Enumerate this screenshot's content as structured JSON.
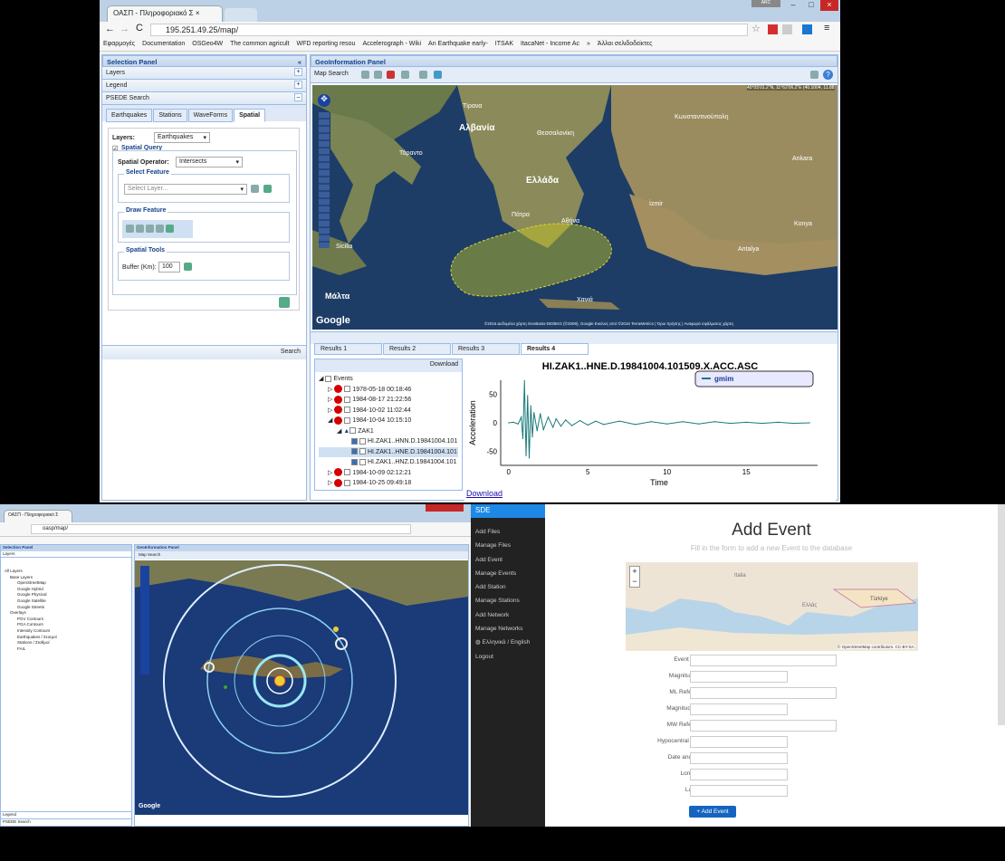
{
  "win1": {
    "tab_title": "ΟΑΣΠ - Πληροφοριακό Σ",
    "url": "195.251.49.25/map/",
    "user_badge": "ARC",
    "bookmarks": [
      "Εφαρμογές",
      "Documentation",
      "OSGeo4W",
      "The common agricult",
      "WFD reporting resou",
      "Accelerograph - Wiki",
      "An Earthquake early-",
      "ITSAK",
      "ItacaNet - Income Ac"
    ],
    "bookmarks_more": "»",
    "other_bookmarks": "Άλλοι σελιδοδείκτες",
    "selection_panel": "Selection Panel",
    "layers": "Layers",
    "legend": "Legend",
    "psede_search": "PSEDE Search",
    "search_tabs": [
      "Earthquakes",
      "Stations",
      "WaveForms",
      "Spatial"
    ],
    "layers_label": "Layers:",
    "layers_value": "Earthquakes",
    "spatial_query": "Spatial Query",
    "spatial_operator_label": "Spatial Operator:",
    "spatial_operator_value": "Intersects",
    "select_feature": "Select Feature",
    "select_layer_placeholder": "Select Layer...",
    "draw_feature": "Draw Feature",
    "spatial_tools": "Spatial Tools",
    "buffer_label": "Buffer (Km):",
    "buffer_value": "100",
    "search_button": "Search",
    "geo_panel": "GeoInformation Panel",
    "map_search": "Map Search",
    "map_coords": "40°05'01.2\"N, 11°62'06.2\"E (40.1004, 11.88",
    "map_labels": {
      "albania": "Αλβανία",
      "greece": "Ελλάδα",
      "malta": "Μάλτα",
      "tirana": "Τίρανα",
      "athens": "Αθήνα",
      "izmir": "İzmir",
      "antalya": "Antalya",
      "istanbul": "Κωνσταντινούπολη",
      "ankara": "Ankara",
      "konya": "Konya",
      "patra": "Πάτρα",
      "thessaloniki": "Θεσσαλονίκη",
      "sicily": "Sicilia",
      "taranto": "Τάραντο",
      "chania": "Χανιά"
    },
    "google": "Google",
    "map_footer": "©2016 Δεδομένα χάρτη GeoBasis-DE/BKG (©2009), Google Εικόνες από ©2016 TerraMetrics | Όροι Χρήσης | Αναφορά σφάλματος χάρτη",
    "result_tabs": [
      "Results 1",
      "Results 2",
      "Results 3",
      "Results 4"
    ],
    "download_button": "Download",
    "tree_root": "Events",
    "tree_events": [
      "1978-05-18 00:18:46",
      "1984-08-17 21:22:56",
      "1984-10-02 11:02:44",
      "1984-10-04 10:15:10"
    ],
    "station": "ZAK1",
    "waveforms": [
      "HI.ZAK1..HNN.D.19841004.101",
      "HI.ZAK1..HNE.D.19841004.101",
      "HI.ZAK1..HNZ.D.19841004.101"
    ],
    "tree_events2": [
      "1984-10-09 02:12:21",
      "1984-10-25 09:49:18"
    ],
    "download_link": "Download"
  },
  "chart_data": {
    "type": "line",
    "title": "HI.ZAK1..HNE.D.19841004.101509.X.ACC.ASC",
    "xlabel": "Time",
    "ylabel": "Acceleration",
    "xlim": [
      -0.5,
      19.5
    ],
    "ylim": [
      -75,
      75
    ],
    "xticks": [
      0,
      5,
      10,
      15
    ],
    "yticks": [
      50,
      0,
      -50
    ],
    "series": [
      {
        "name": "gmim",
        "color": "#1a7a7a",
        "x": [
          0,
          0.3,
          0.6,
          0.8,
          0.9,
          1.0,
          1.1,
          1.2,
          1.3,
          1.4,
          1.5,
          1.6,
          1.8,
          2.0,
          2.2,
          2.5,
          2.8,
          3.0,
          3.3,
          3.6,
          4.0,
          4.5,
          5.0,
          5.5,
          6.0,
          7.0,
          8.0,
          9.0,
          10.0,
          11.0,
          12.0,
          13.0,
          14.0,
          15.0,
          16.0,
          17.0,
          18.0,
          19.0
        ],
        "y": [
          0,
          1,
          -2,
          10,
          -28,
          74,
          -58,
          48,
          -62,
          30,
          -25,
          18,
          -14,
          16,
          -12,
          10,
          -8,
          7,
          -6,
          5,
          -5,
          4,
          -4,
          3,
          -3,
          3,
          -3,
          2,
          -2,
          2,
          -2,
          2,
          -1,
          1,
          -1,
          1,
          -1,
          0
        ]
      }
    ],
    "legend": "top-right",
    "grid": false
  },
  "win2": {
    "tab_title": "ΟΑΣΠ - Πληροφοριακό Σ",
    "url": "oasp/map/",
    "selection_panel": "Selection Panel",
    "layers": "Layers",
    "geo_panel": "GeoInformation Panel",
    "map_search": "Map Search",
    "layer_tree": [
      "All Layers",
      "Base Layers",
      "OpenStreetMap",
      "Google Hybrid",
      "Google Physical",
      "Google Satellite",
      "Google Streets",
      "Overlays",
      "PGV Contours",
      "PGA Contours",
      "Intensity Contours",
      "Earthquakes / Σεισμοί",
      "Stations / Σταθμοί",
      "FAIL"
    ],
    "legend": "Legend",
    "psede_search": "PSEDE Search",
    "google": "Google"
  },
  "win3": {
    "brand": "SDE",
    "nav": [
      "Add Files",
      "Manage Files",
      "Add Event",
      "Manage Events",
      "Add Station",
      "Manage Stations",
      "Add Network",
      "Manage Networks",
      "Ελληνικά / English",
      "Logout"
    ],
    "title": "Add Event",
    "subtitle": "Fill in the form to add a new Event to the database",
    "map_attrib": "© OpenStreetMap contributors. CC-BY-SA",
    "map_labels": {
      "turkey": "Türkiye",
      "italy": "Italia",
      "greece": "Ελλάς"
    },
    "fields": [
      "Event Name",
      "Magnitude ML",
      "ML Reference",
      "Magnitude MW",
      "MW Reference",
      "Hypocentral Depth",
      "Date and Time",
      "Longitude",
      "Latitude"
    ],
    "submit": "+ Add Event"
  }
}
